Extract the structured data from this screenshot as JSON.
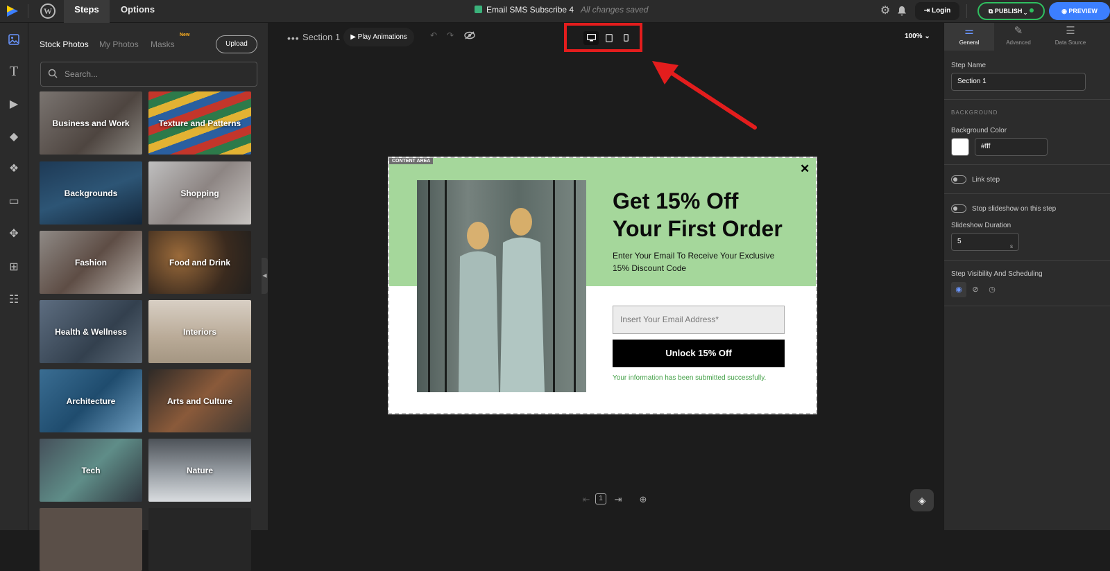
{
  "topbar": {
    "tabs": [
      {
        "label": "Steps"
      },
      {
        "label": "Options"
      }
    ],
    "doc_title": "Email SMS Subscribe 4",
    "save_status": "All changes saved",
    "login_label": "Login",
    "publish_label": "PUBLISH",
    "preview_label": "PREVIEW",
    "colors": {
      "publish": "#2fbf5f",
      "preview": "#3c7fff"
    }
  },
  "rail": {
    "items": [
      {
        "icon": "image-icon"
      },
      {
        "icon": "text-icon"
      },
      {
        "icon": "video-icon"
      },
      {
        "icon": "shapes-icon"
      },
      {
        "icon": "elements-icon"
      },
      {
        "icon": "button-icon"
      },
      {
        "icon": "move-icon"
      },
      {
        "icon": "add-icon"
      },
      {
        "icon": "form-icon"
      }
    ]
  },
  "photos": {
    "tabs": [
      {
        "label": "Stock Photos"
      },
      {
        "label": "My Photos"
      },
      {
        "label": "Masks"
      }
    ],
    "new_badge": "New",
    "upload_label": "Upload",
    "search_placeholder": "Search...",
    "categories": [
      {
        "label": "Business and Work"
      },
      {
        "label": "Texture and Patterns"
      },
      {
        "label": "Backgrounds"
      },
      {
        "label": "Shopping"
      },
      {
        "label": "Fashion"
      },
      {
        "label": "Food and Drink"
      },
      {
        "label": "Health & Wellness"
      },
      {
        "label": "Interiors"
      },
      {
        "label": "Architecture"
      },
      {
        "label": "Arts and Culture"
      },
      {
        "label": "Tech"
      },
      {
        "label": "Nature"
      }
    ]
  },
  "canvas": {
    "section_name": "Section 1",
    "play_label": "Play Animations",
    "zoom": "100%",
    "devices": [
      {
        "icon": "desktop-icon"
      },
      {
        "icon": "tablet-icon"
      },
      {
        "icon": "mobile-icon"
      }
    ]
  },
  "popup": {
    "content_tag": "CONTENT AREA",
    "headline_line1": "Get 15% Off",
    "headline_line2": "Your First Order",
    "subtitle": "Enter Your Email To Receive Your Exclusive 15% Discount Code",
    "email_placeholder": "Insert Your Email Address*",
    "cta_label": "Unlock 15% Off",
    "success_message": "Your information has been submitted successfully.",
    "colors": {
      "top_band": "#a5d79b",
      "success": "#43a047"
    }
  },
  "pager": {
    "page": "1"
  },
  "settings": {
    "tabs": [
      {
        "label": "General"
      },
      {
        "label": "Advanced"
      },
      {
        "label": "Data Source"
      }
    ],
    "step_name_label": "Step Name",
    "step_name_value": "Section 1",
    "background_section": "BACKGROUND",
    "bg_color_label": "Background Color",
    "bg_color_value": "#fff",
    "link_step_label": "Link step",
    "stop_slideshow_label": "Stop slideshow on this step",
    "slideshow_duration_label": "Slideshow Duration",
    "slideshow_duration_value": "5",
    "slideshow_duration_unit": "s",
    "visibility_label": "Step Visibility And Scheduling"
  }
}
